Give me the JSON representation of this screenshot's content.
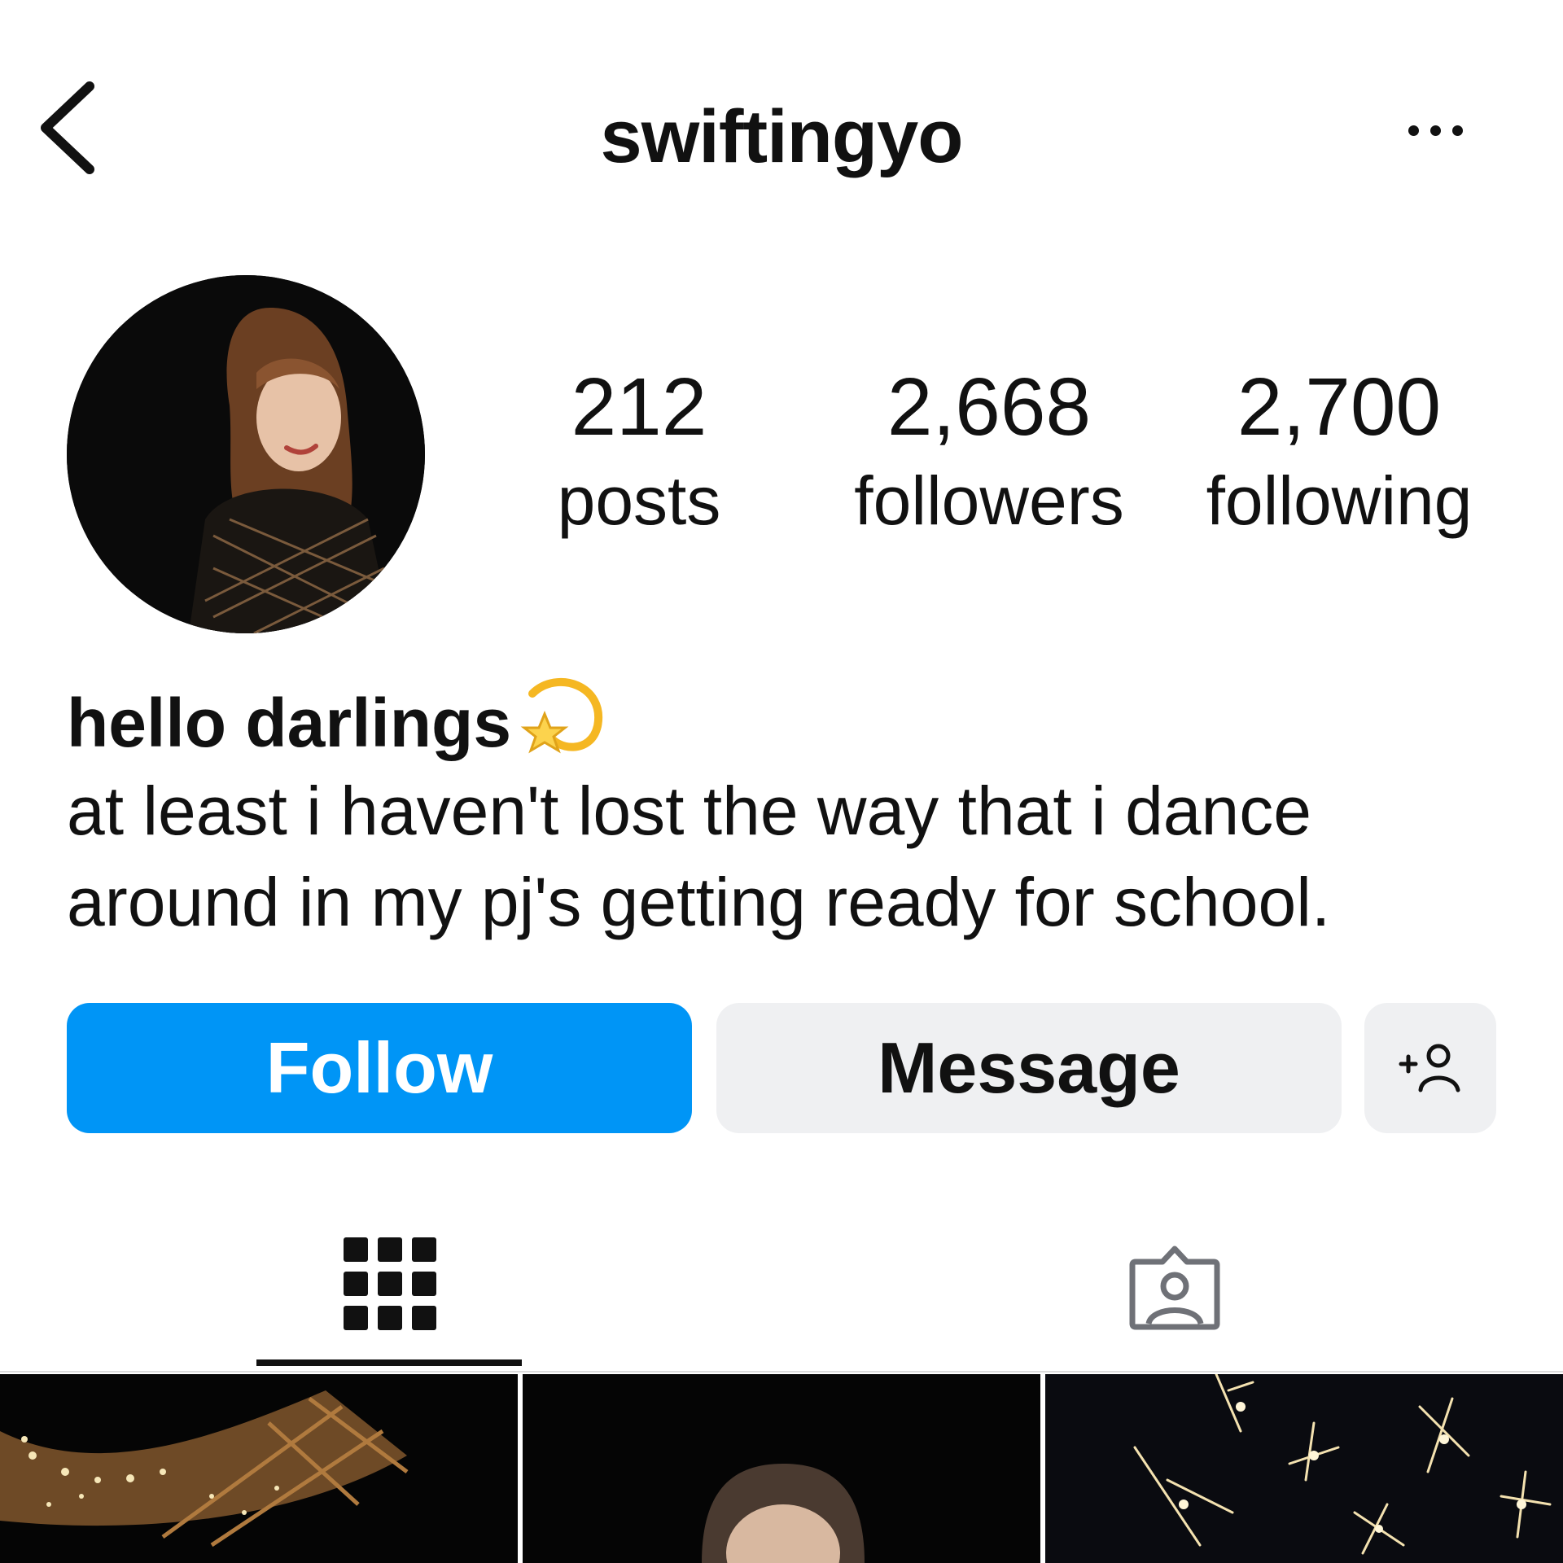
{
  "header": {
    "username": "swiftingyo",
    "back_icon": "chevron-left-icon",
    "more_icon": "more-horizontal-icon"
  },
  "profile": {
    "avatar_icon": "profile-avatar",
    "stats": {
      "posts": {
        "value": "212",
        "label": "posts"
      },
      "followers": {
        "value": "2,668",
        "label": "followers"
      },
      "following": {
        "value": "2,700",
        "label": "following"
      }
    }
  },
  "bio": {
    "name": "hello darlings",
    "emoji_icon": "dizzy-star-emoji",
    "line1": "at least i haven't lost the way that i dance",
    "line2": "around in my pj's getting ready for school."
  },
  "actions": {
    "follow_label": "Follow",
    "message_label": "Message",
    "add_user_icon": "add-person-icon"
  },
  "colors": {
    "follow_button": "#0095f6",
    "secondary_button": "#eff0f2",
    "text": "#111111"
  },
  "tabs": [
    {
      "icon": "grid-icon",
      "active": true
    },
    {
      "icon": "tagged-person-icon",
      "active": false
    }
  ],
  "posts": [
    {
      "icon": "eiffel-tower-lights-thumbnail"
    },
    {
      "icon": "portrait-photo-thumbnail"
    },
    {
      "icon": "sparklers-thumbnail"
    }
  ]
}
